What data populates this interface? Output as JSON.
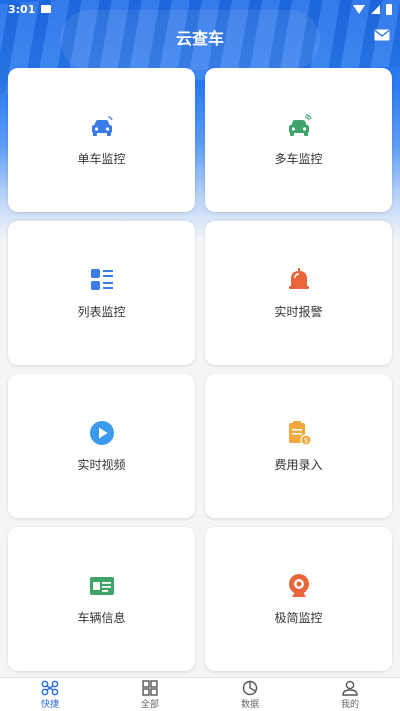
{
  "status": {
    "time": "3:01"
  },
  "header": {
    "title": "云查车"
  },
  "cards": [
    {
      "label": "单车监控",
      "icon": "car-icon",
      "color": "#3b7be8"
    },
    {
      "label": "多车监控",
      "icon": "multi-car-icon",
      "color": "#3fa46a"
    },
    {
      "label": "列表监控",
      "icon": "list-icon",
      "color": "#3b7be8"
    },
    {
      "label": "实时报警",
      "icon": "alarm-bell-icon",
      "color": "#e8663a"
    },
    {
      "label": "实时视频",
      "icon": "play-icon",
      "color": "#3d9bef"
    },
    {
      "label": "费用录入",
      "icon": "expense-clipboard-icon",
      "color": "#f0a93a"
    },
    {
      "label": "车辆信息",
      "icon": "vehicle-card-icon",
      "color": "#3fa46a"
    },
    {
      "label": "极简监控",
      "icon": "webcam-icon",
      "color": "#e8663a"
    }
  ],
  "tabs": [
    {
      "label": "快捷",
      "icon": "quick-icon",
      "active": true
    },
    {
      "label": "全部",
      "icon": "grid-icon",
      "active": false
    },
    {
      "label": "数据",
      "icon": "pie-chart-icon",
      "active": false
    },
    {
      "label": "我的",
      "icon": "user-icon",
      "active": false
    }
  ],
  "colors": {
    "primary": "#2a6fe0",
    "background": "#f4f5f7"
  }
}
